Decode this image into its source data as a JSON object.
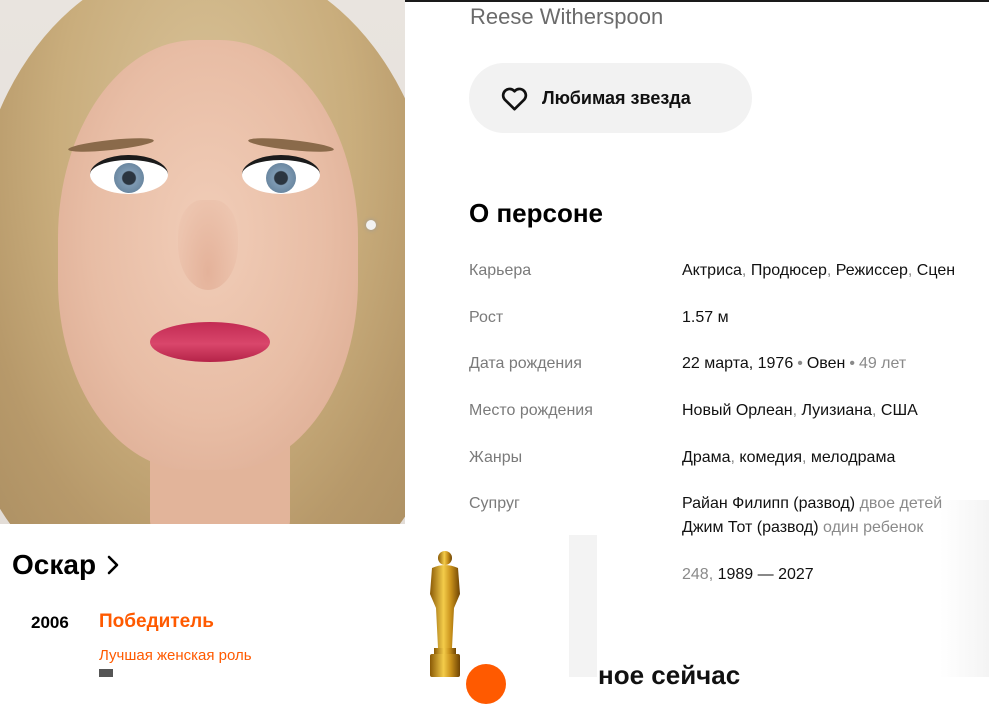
{
  "person": {
    "name_original": "Reese Witherspoon",
    "favorite_label": "Любимая звезда",
    "about_title": "О персоне"
  },
  "info": {
    "career": {
      "label": "Карьера",
      "items": [
        "Актриса",
        "Продюсер",
        "Режиссер",
        "Сцен"
      ]
    },
    "height": {
      "label": "Рост",
      "value": "1.57 м"
    },
    "birth_date": {
      "label": "Дата рождения",
      "date": "22 марта, 1976",
      "zodiac": "Овен",
      "age": "49 лет"
    },
    "birth_place": {
      "label": "Место рождения",
      "city": "Новый Орлеан",
      "region": "Луизиана",
      "country": "США"
    },
    "genres": {
      "label": "Жанры",
      "items": [
        "Драма",
        "комедия",
        "мелодрама"
      ]
    },
    "spouse": {
      "label": "Супруг",
      "entries": [
        {
          "name": "Райан Филипп (развод)",
          "note": "двое детей"
        },
        {
          "name": "Джим Тот (развод)",
          "note": "один ребенок"
        }
      ]
    },
    "films": {
      "count": "248",
      "years": "1989 — 2027"
    }
  },
  "awards": {
    "title": "Оскар",
    "year": "2006",
    "status": "Победитель",
    "category": "Лучшая женская роль"
  },
  "partial_heading": "ное сейчас",
  "colors": {
    "accent": "#ff5a00",
    "muted": "#7a7a7a",
    "button_bg": "#f2f2f2"
  }
}
